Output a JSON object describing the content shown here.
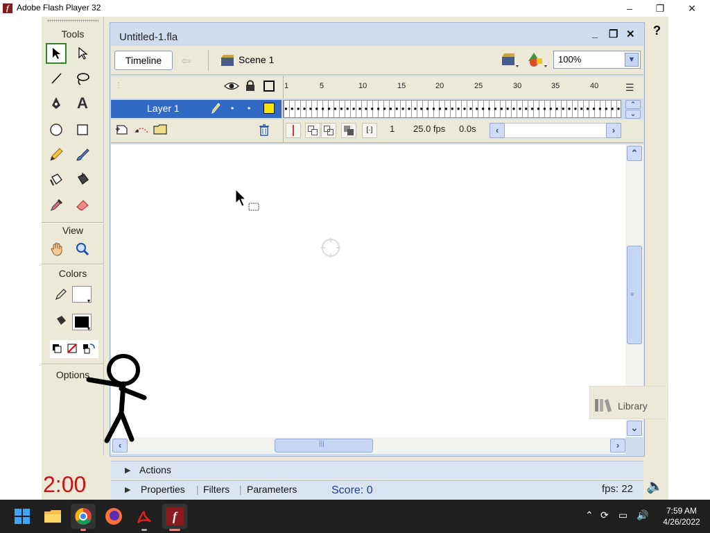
{
  "window": {
    "title": "Adobe Flash Player 32",
    "minimize_glyph": "–",
    "maximize_glyph": "❐",
    "close_glyph": "✕"
  },
  "tools_panel": {
    "title": "Tools",
    "view_label": "View",
    "colors_label": "Colors",
    "options_label": "Options",
    "tools": [
      {
        "name": "selection-tool",
        "glyph": "↖"
      },
      {
        "name": "subselection-tool",
        "glyph": "↖"
      },
      {
        "name": "line-tool",
        "glyph": "／"
      },
      {
        "name": "lasso-tool",
        "glyph": "ϕ"
      },
      {
        "name": "pen-tool",
        "glyph": "✒"
      },
      {
        "name": "text-tool",
        "glyph": "A"
      },
      {
        "name": "oval-tool",
        "glyph": "○"
      },
      {
        "name": "rectangle-tool",
        "glyph": "□"
      },
      {
        "name": "pencil-tool",
        "glyph": "✏"
      },
      {
        "name": "brush-tool",
        "glyph": "🖌"
      },
      {
        "name": "ink-bottle-tool",
        "glyph": "⛉"
      },
      {
        "name": "paint-bucket-tool",
        "glyph": "⛟"
      },
      {
        "name": "eyedropper-tool",
        "glyph": "💉"
      },
      {
        "name": "eraser-tool",
        "glyph": "⌫"
      }
    ]
  },
  "document": {
    "tab_title": "Untitled-1.fla",
    "timeline_button": "Timeline",
    "scene_label": "Scene 1",
    "zoom": "100%",
    "help_glyph": "?"
  },
  "timeline": {
    "layer_name": "Layer 1",
    "ruler_numbers": [
      "1",
      "5",
      "10",
      "15",
      "20",
      "25",
      "30",
      "35",
      "40"
    ],
    "current_frame": "1",
    "frame_rate": "25.0 fps",
    "elapsed": "0.0s"
  },
  "library": {
    "label": "Library"
  },
  "panels": {
    "actions": "Actions",
    "properties": "Properties",
    "filters": "Filters",
    "parameters": "Parameters"
  },
  "overlay": {
    "timer": "2:00",
    "score": "Score: 0",
    "fps": "fps: 22"
  },
  "taskbar": {
    "time": "7:59 AM",
    "date": "4/26/2022",
    "apps": [
      "start",
      "file-explorer",
      "chrome",
      "firefox",
      "acrobat",
      "flash"
    ]
  },
  "colors": {
    "accent": "#316ac5",
    "timer": "#cc1111",
    "score": "#1a3aa8",
    "taskbar": "#1f1f1f",
    "flash_icon": "#8b1a1a"
  }
}
